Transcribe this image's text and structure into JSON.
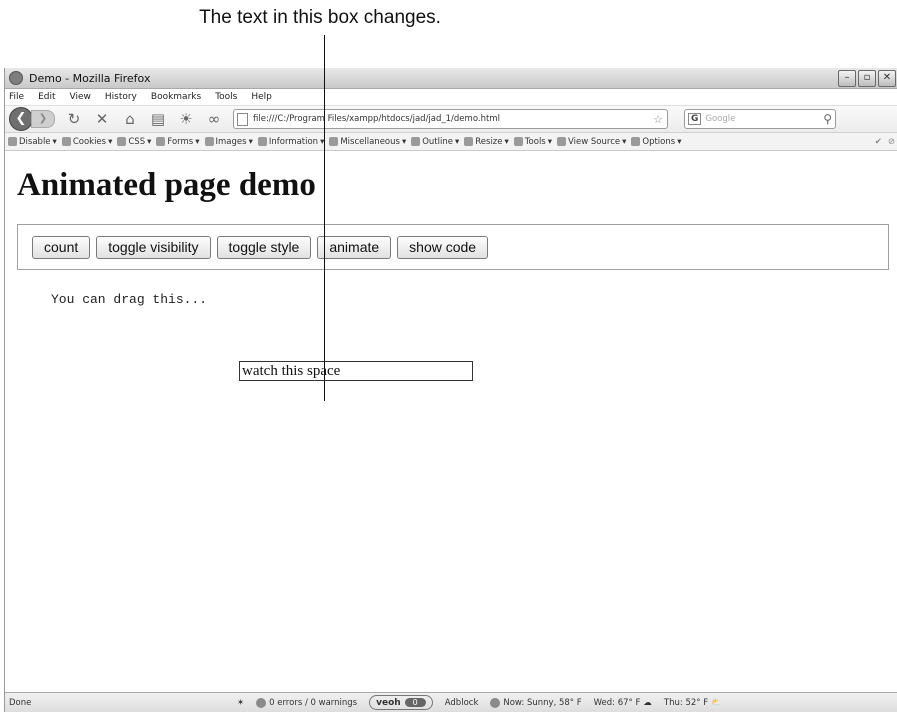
{
  "annotation": {
    "text": "The text in this box changes."
  },
  "window": {
    "title": "Demo - Mozilla Firefox",
    "controls": [
      "–",
      "▫",
      "✕"
    ]
  },
  "menu": [
    "File",
    "Edit",
    "View",
    "History",
    "Bookmarks",
    "Tools",
    "Help"
  ],
  "nav": {
    "url": "file:///C:/Program Files/xampp/htdocs/jad/jad_1/demo.html",
    "search_placeholder": "Google",
    "search_engine": "G"
  },
  "devtoolbar": [
    "Disable",
    "Cookies",
    "CSS",
    "Forms",
    "Images",
    "Information",
    "Miscellaneous",
    "Outline",
    "Resize",
    "Tools",
    "View Source",
    "Options"
  ],
  "page": {
    "heading": "Animated page demo",
    "buttons": [
      "count",
      "toggle visibility",
      "toggle style",
      "animate",
      "show code"
    ],
    "drag_text": "You can drag this...",
    "watch_box": "watch this space"
  },
  "status": {
    "text": "Done",
    "errors": "0 errors / 0 warnings",
    "veoh": "veoh",
    "veoh_count": "0",
    "adblock": "Adblock",
    "weather_now": "Now: Sunny, 58° F",
    "weather_wed": "Wed: 67° F",
    "weather_thu": "Thu: 52° F"
  }
}
